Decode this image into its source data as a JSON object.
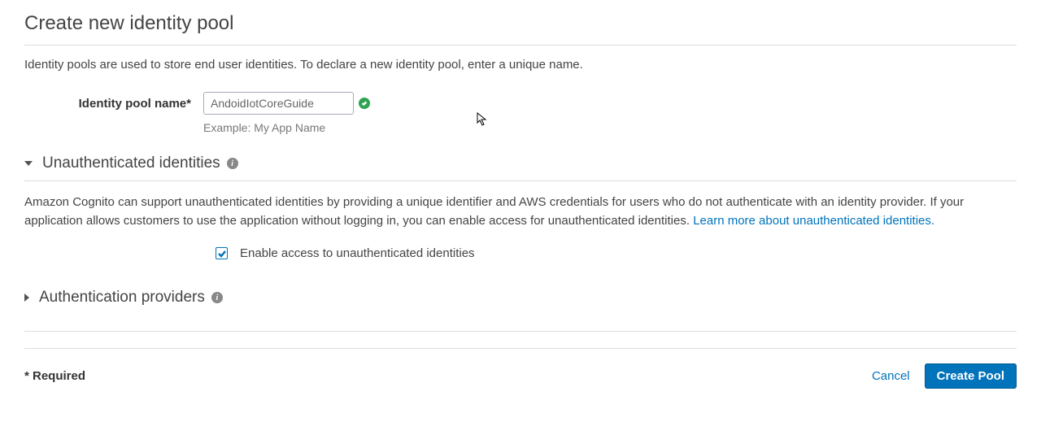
{
  "page": {
    "title": "Create new identity pool",
    "description": "Identity pools are used to store end user identities. To declare a new identity pool, enter a unique name."
  },
  "form": {
    "pool_name_label": "Identity pool name*",
    "pool_name_value": "AndoidIotCoreGuide",
    "pool_name_example": "Example: My App Name"
  },
  "sections": {
    "unauth": {
      "title": "Unauthenticated identities",
      "body": "Amazon Cognito can support unauthenticated identities by providing a unique identifier and AWS credentials for users who do not authenticate with an identity provider. If your application allows customers to use the application without logging in, you can enable access for unauthenticated identities. ",
      "learn_more": "Learn more about unauthenticated identities.",
      "checkbox_label": "Enable access to unauthenticated identities"
    },
    "auth_providers": {
      "title": "Authentication providers"
    }
  },
  "footer": {
    "required": "* Required",
    "cancel": "Cancel",
    "create": "Create Pool"
  }
}
